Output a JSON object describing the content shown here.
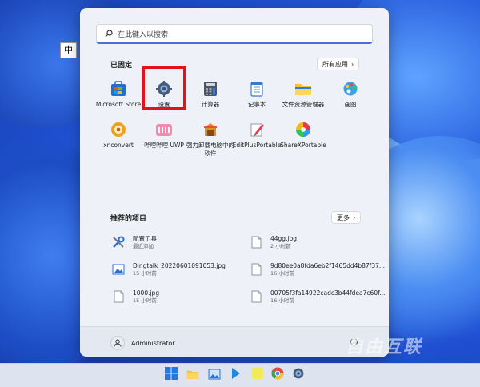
{
  "ime": {
    "label": "中"
  },
  "search": {
    "placeholder": "在此键入以搜索"
  },
  "pinned": {
    "title": "已固定",
    "all_apps_label": "所有应用",
    "apps": [
      {
        "label": "Microsoft Store",
        "icon": "microsoft-store-icon"
      },
      {
        "label": "设置",
        "icon": "settings-gear-icon"
      },
      {
        "label": "计算器",
        "icon": "calculator-icon"
      },
      {
        "label": "记事本",
        "icon": "notepad-icon"
      },
      {
        "label": "文件资源管理器",
        "icon": "folder-icon"
      },
      {
        "label": "画图",
        "icon": "paint-palette-icon"
      },
      {
        "label": "xnconvert",
        "icon": "xnconvert-icon"
      },
      {
        "label": "哔哩哔哩 UWP",
        "icon": "bilibili-icon"
      },
      {
        "label": "强力卸载电脑中的软件",
        "icon": "uninstaller-icon"
      },
      {
        "label": "EditPlusPortable",
        "icon": "editplus-icon"
      },
      {
        "label": "ShareXPortable",
        "icon": "sharex-icon"
      }
    ]
  },
  "recommended": {
    "title": "推荐的项目",
    "more_label": "更多",
    "items": [
      {
        "title": "配置工具",
        "subtitle": "最近添加",
        "icon": "tools-icon"
      },
      {
        "title": "44gg.jpg",
        "subtitle": "2 小时前",
        "icon": "file-icon"
      },
      {
        "title": "Dingtalk_20220601091053.jpg",
        "subtitle": "15 小时前",
        "icon": "image-file-icon"
      },
      {
        "title": "9d80ee0a8fda6eb2f1465dd4b87f37...",
        "subtitle": "16 小时前",
        "icon": "file-icon"
      },
      {
        "title": "1000.jpg",
        "subtitle": "15 小时前",
        "icon": "file-icon"
      },
      {
        "title": "00705f3fa14922cadc3b44fdea7c60f...",
        "subtitle": "16 小时前",
        "icon": "file-icon"
      }
    ]
  },
  "user": {
    "name": "Administrator"
  },
  "watermark": {
    "text": "自由互联"
  },
  "colors": {
    "accent": "#4a6fd0",
    "highlight": "#e0141e"
  }
}
